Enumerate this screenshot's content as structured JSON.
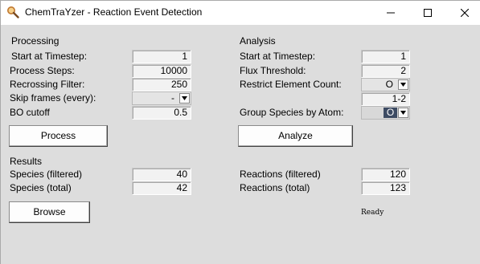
{
  "window": {
    "title": "ChemTraYzer - Reaction Event Detection"
  },
  "processing": {
    "section_label": "Processing",
    "start_timestep": {
      "label": "Start at Timestep:",
      "value": "1"
    },
    "process_steps": {
      "label": "Process Steps:",
      "value": "10000"
    },
    "recrossing_filter": {
      "label": "Recrossing Filter:",
      "value": "250"
    },
    "skip_frames": {
      "label": "Skip frames (every):",
      "value": "-"
    },
    "bo_cutoff": {
      "label": "BO cutoff",
      "value": "0.5"
    },
    "process_button": "Process"
  },
  "analysis": {
    "section_label": "Analysis",
    "start_timestep": {
      "label": "Start at Timestep:",
      "value": "1"
    },
    "flux_threshold": {
      "label": "Flux Threshold:",
      "value": "2"
    },
    "restrict_element": {
      "label": "Restrict Element Count:",
      "value": "O",
      "range": "1-2"
    },
    "group_by_atom": {
      "label": "Group Species by Atom:",
      "value": "O"
    },
    "analyze_button": "Analyze"
  },
  "results": {
    "section_label": "Results",
    "species_filtered": {
      "label": "Species (filtered)",
      "value": "40"
    },
    "species_total": {
      "label": "Species (total)",
      "value": "42"
    },
    "reactions_filtered": {
      "label": "Reactions (filtered)",
      "value": "120"
    },
    "reactions_total": {
      "label": "Reactions (total)",
      "value": "123"
    },
    "browse_button": "Browse"
  },
  "status": "Ready",
  "icons": {
    "app": "magnifier-icon",
    "minimize": "minimize-icon",
    "maximize": "maximize-icon",
    "close": "close-icon",
    "dropdown": "chevron-down-icon"
  }
}
